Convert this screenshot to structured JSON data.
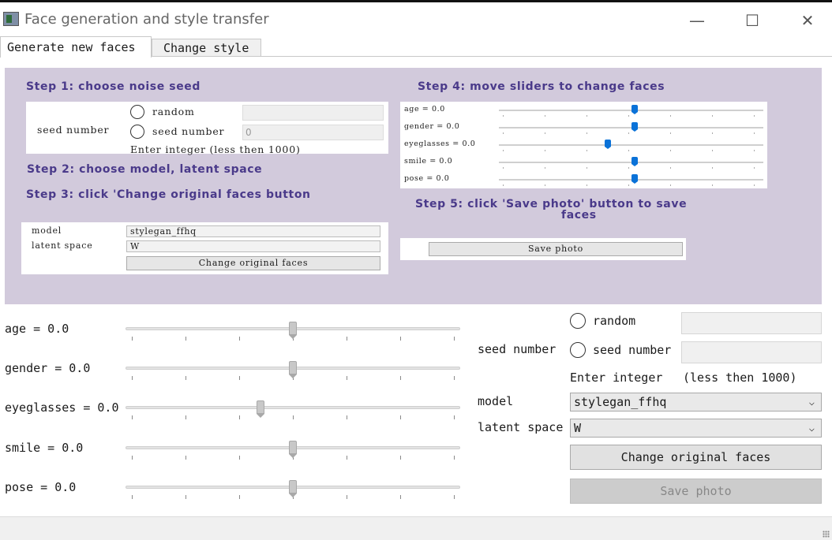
{
  "window": {
    "title": "Face generation and style transfer",
    "minimize_glyph": "—",
    "maximize_glyph": "☐",
    "close_glyph": "✕"
  },
  "tabs": [
    {
      "label": "Generate new faces",
      "active": true
    },
    {
      "label": "Change style",
      "active": false
    }
  ],
  "guide": {
    "step1": "Step 1:  choose noise seed",
    "step2": "Step 2:  choose model, latent space",
    "step3": "Step 3:  click 'Change original faces button",
    "step4": "Step 4:  move sliders to change faces",
    "step5_line1": "Step 5:  click 'Save photo' button to save",
    "step5_line2": "faces",
    "seed_label": "seed number",
    "radio_random": "random",
    "radio_seed": "seed number",
    "seed_value": "0",
    "hint": "Enter integer   (less then 1000)",
    "model_label": "model",
    "model_value": "stylegan_ffhq",
    "latent_label": "latent space",
    "latent_value": "W",
    "change_button": "Change original faces",
    "save_button": "Save photo",
    "sliders": [
      {
        "label": "age = 0.0",
        "level": 0.5
      },
      {
        "label": "gender = 0.0",
        "level": 0.5
      },
      {
        "label": "eyeglasses = 0.0",
        "level": 0.4
      },
      {
        "label": "smile = 0.0",
        "level": 0.5
      },
      {
        "label": "pose = 0.0",
        "level": 0.5
      }
    ]
  },
  "sliders": [
    {
      "label": "age = 0.0",
      "level": 0.5
    },
    {
      "label": "gender = 0.0",
      "level": 0.5
    },
    {
      "label": "eyeglasses = 0.0",
      "level": 0.4
    },
    {
      "label": "smile = 0.0",
      "level": 0.5
    },
    {
      "label": "pose = 0.0",
      "level": 0.5
    }
  ],
  "seed": {
    "label": "seed number",
    "radio_random": "random",
    "radio_seed": "seed number",
    "random_value": "",
    "seed_value": "",
    "hint_left": "Enter integer",
    "hint_right": "(less then 1000)"
  },
  "model": {
    "label": "model",
    "value": "stylegan_ffhq"
  },
  "latent": {
    "label": "latent space",
    "value": "W"
  },
  "buttons": {
    "change": "Change original faces",
    "save": "Save photo"
  },
  "icons": {
    "chevron": "⌵"
  }
}
